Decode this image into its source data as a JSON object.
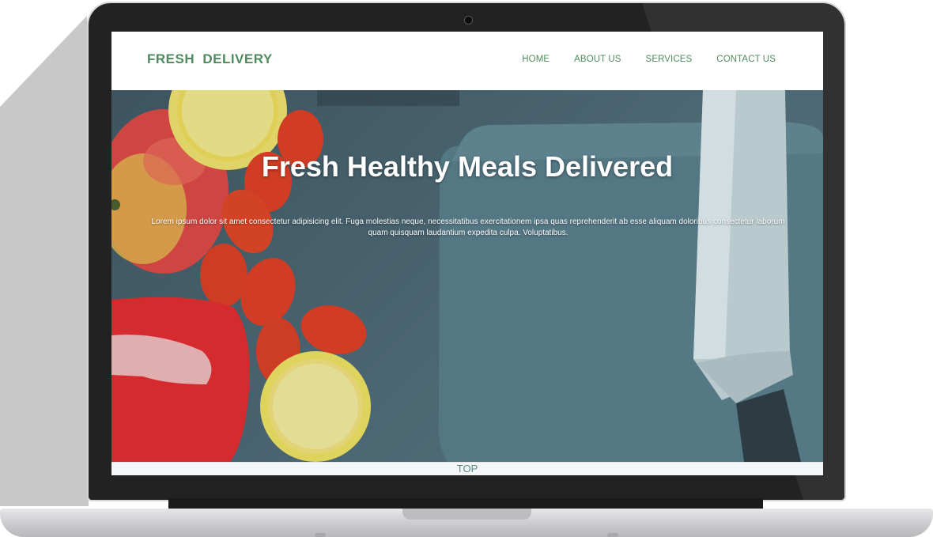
{
  "site": {
    "logo": "FRESH   DELIVERY",
    "nav": [
      {
        "label": "HOME"
      },
      {
        "label": "ABOUT US"
      },
      {
        "label": "SERVICES"
      },
      {
        "label": "CONTACT US"
      }
    ]
  },
  "hero": {
    "title": "Fresh Healthy Meals Delivered",
    "text": "Lorem ipsum dolor sit amet consectetur adipisicing elit. Fuga molestias neque, necessitatibus exercitationem ipsa quas reprehenderit ab esse aliquam doloribus consectetur laborum quam quisquam laudantium expedita culpa. Voluptatibus."
  },
  "footer": {
    "top_link": "TOP"
  },
  "colors": {
    "brand_green": "#4f8b5e",
    "hero_slate": "#4e6a76",
    "laptop_bezel": "#222222"
  },
  "icons": [
    "camera-icon"
  ]
}
